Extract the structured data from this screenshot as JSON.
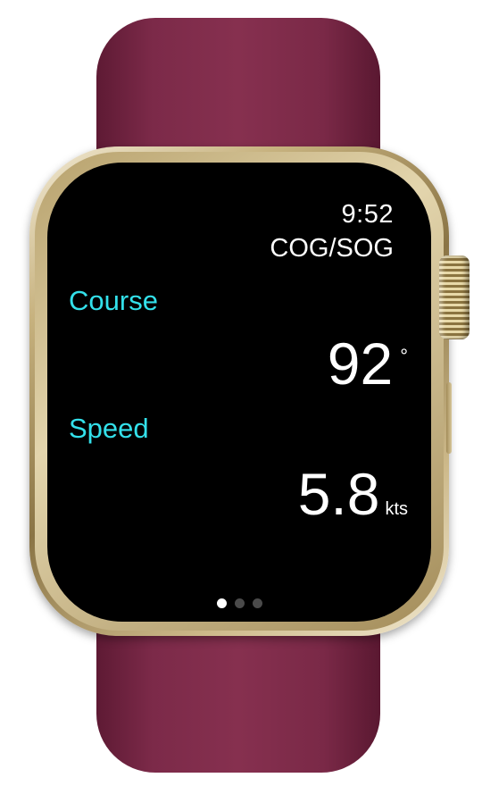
{
  "status_bar": {
    "time": "9:52"
  },
  "screen": {
    "title": "COG/SOG"
  },
  "course": {
    "label": "Course",
    "value": "92",
    "unit": "°"
  },
  "speed": {
    "label": "Speed",
    "value": "5.8",
    "unit": "kts"
  },
  "page_indicator": {
    "total": 3,
    "active_index": 0
  },
  "colors": {
    "label_accent": "#33e0ea",
    "background": "#000000",
    "text": "#ffffff",
    "band": "#7c2a49",
    "case": "#c7b27f"
  }
}
